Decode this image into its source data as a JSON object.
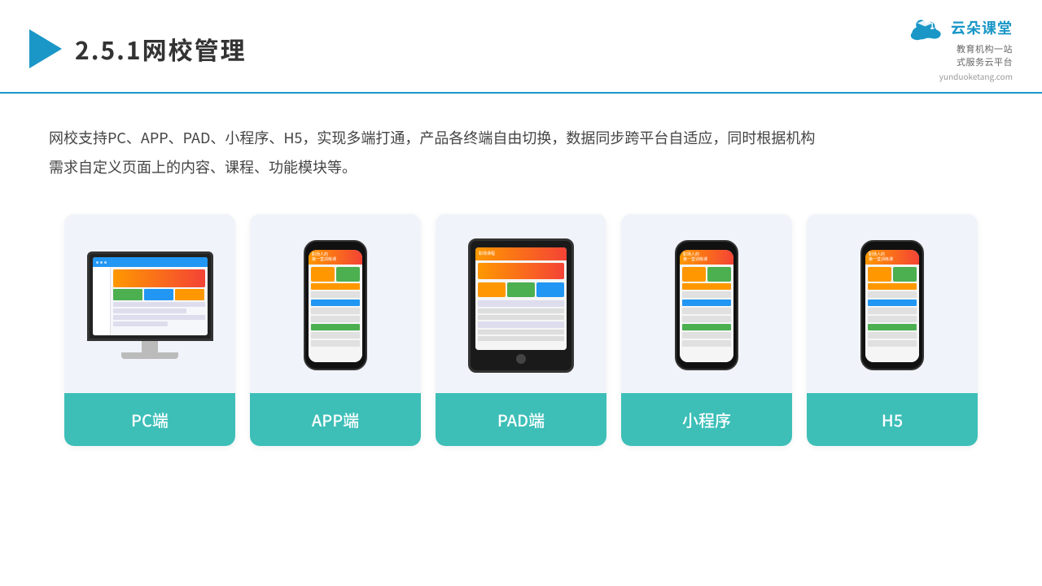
{
  "header": {
    "title_prefix": "2.5.1",
    "title_main": "网校管理",
    "logo_text": "云朵课堂",
    "logo_sub1": "教育机构一站",
    "logo_sub2": "式服务云平台",
    "logo_url": "yunduoketang.com"
  },
  "description": {
    "text": "网校支持PC、APP、PAD、小程序、H5，实现多端打通，产品各终端自由切换，数据同步跨平台自适应，同时根据机构需求自定义页面上的内容、课程、功能模块等。"
  },
  "cards": [
    {
      "id": "pc",
      "label": "PC端"
    },
    {
      "id": "app",
      "label": "APP端"
    },
    {
      "id": "pad",
      "label": "PAD端"
    },
    {
      "id": "miniprogram",
      "label": "小程序"
    },
    {
      "id": "h5",
      "label": "H5"
    }
  ],
  "colors": {
    "accent": "#1a97c7",
    "teal": "#3dbfb8",
    "card_bg": "#f0f4fa",
    "orange": "#FF9800",
    "red": "#f44336",
    "blue": "#2196F3",
    "green": "#4CAF50"
  }
}
